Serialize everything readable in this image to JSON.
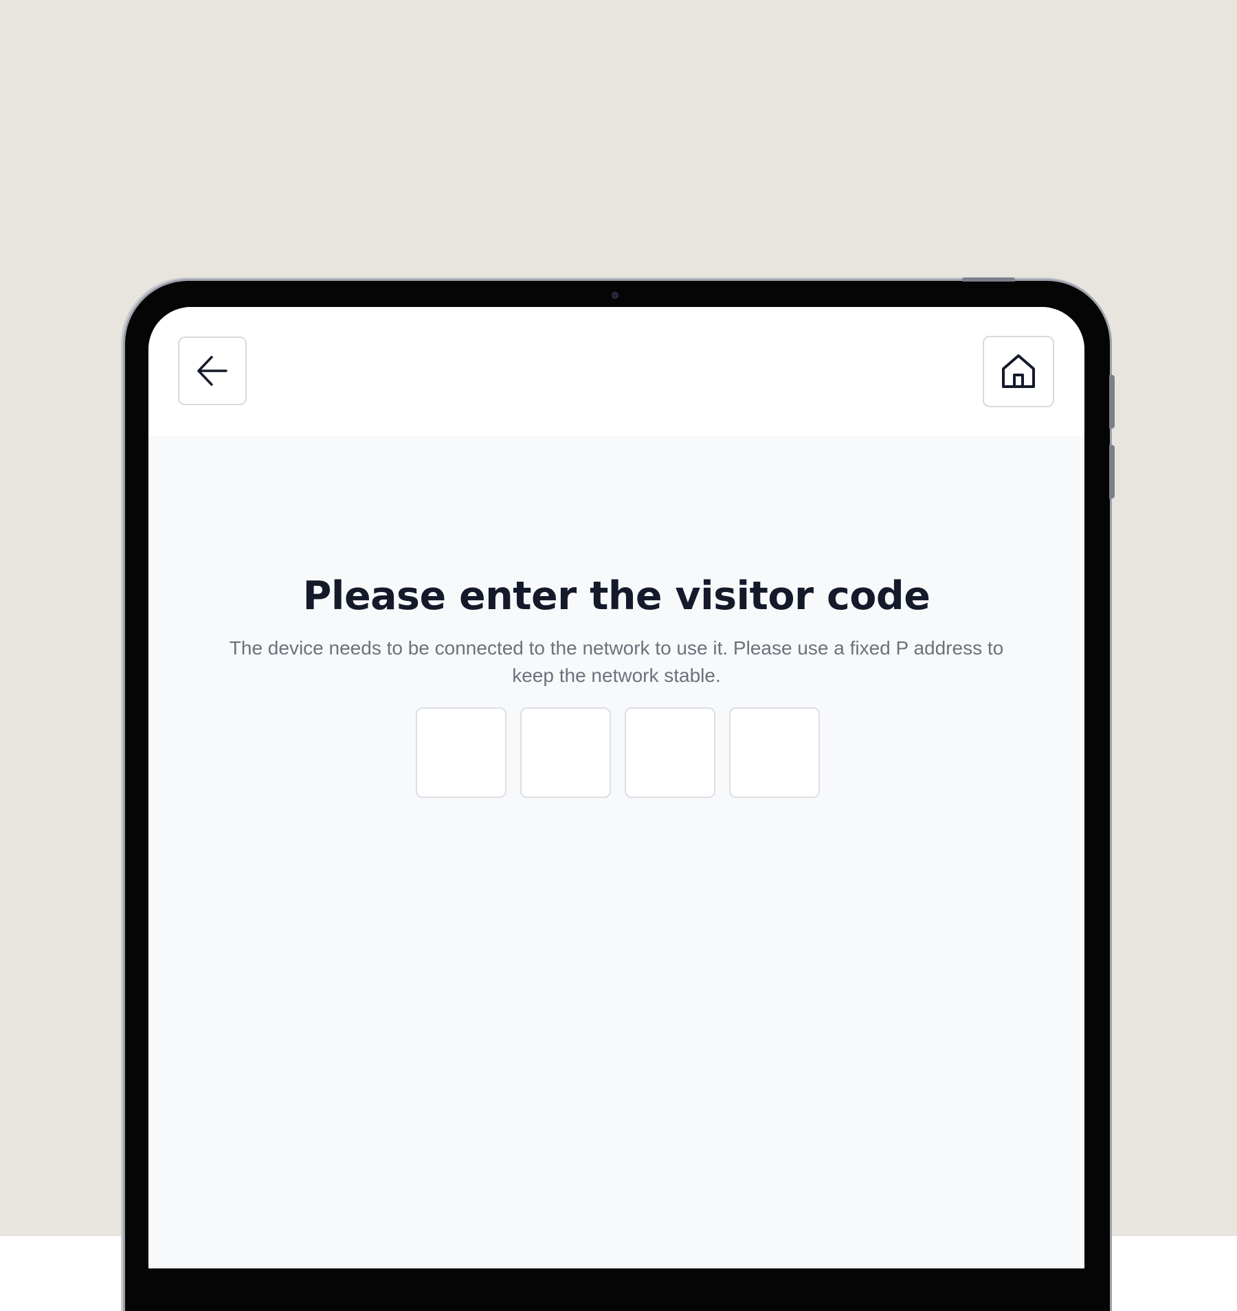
{
  "colors": {
    "background": "#e8e5de",
    "device_frame": "#050505",
    "screen_header": "#ffffff",
    "screen_body": "#f7f9fb",
    "title_text": "#141a2a",
    "subtitle_text": "#6c717b",
    "box_border": "#dcdfe4"
  },
  "toolbar": {
    "back_icon": "arrow-left-icon",
    "home_icon": "home-icon"
  },
  "main": {
    "title": "Please enter the visitor code",
    "subtitle": "The device needs to be connected to the network to use it. Please use a fixed P address to keep the network stable."
  },
  "code_inputs": [
    {
      "value": ""
    },
    {
      "value": ""
    },
    {
      "value": ""
    },
    {
      "value": ""
    }
  ]
}
